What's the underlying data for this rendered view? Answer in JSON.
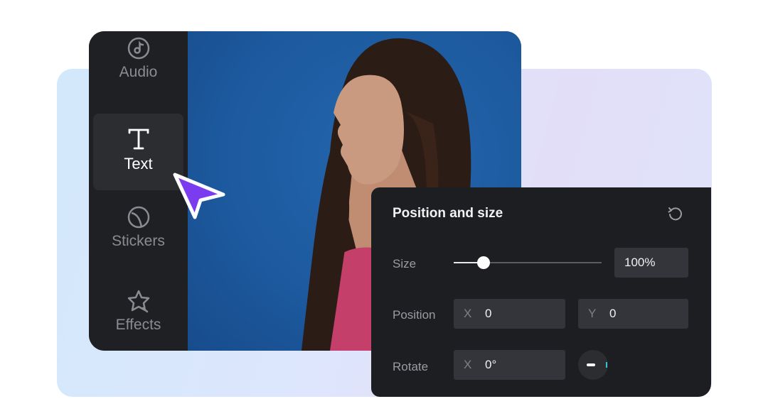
{
  "sidebar": {
    "items": [
      {
        "label": "Audio",
        "icon": "audio-icon"
      },
      {
        "label": "Text",
        "icon": "text-icon",
        "active": true
      },
      {
        "label": "Stickers",
        "icon": "stickers-icon"
      },
      {
        "label": "Effects",
        "icon": "effects-icon"
      }
    ]
  },
  "panel": {
    "title": "Position and size",
    "size": {
      "label": "Size",
      "value": "100%",
      "slider_fraction": 0.2
    },
    "position": {
      "label": "Position",
      "x_axis": "X",
      "x_value": "0",
      "y_axis": "Y",
      "y_value": "0"
    },
    "rotate": {
      "label": "Rotate",
      "x_axis": "X",
      "x_value": "0°"
    }
  },
  "colors": {
    "accent_cursor": "#7b3cf0",
    "panel_bg": "#1d1e21",
    "photo_bg": "#1d5a9f",
    "dial_accent": "#2ec4d6"
  }
}
